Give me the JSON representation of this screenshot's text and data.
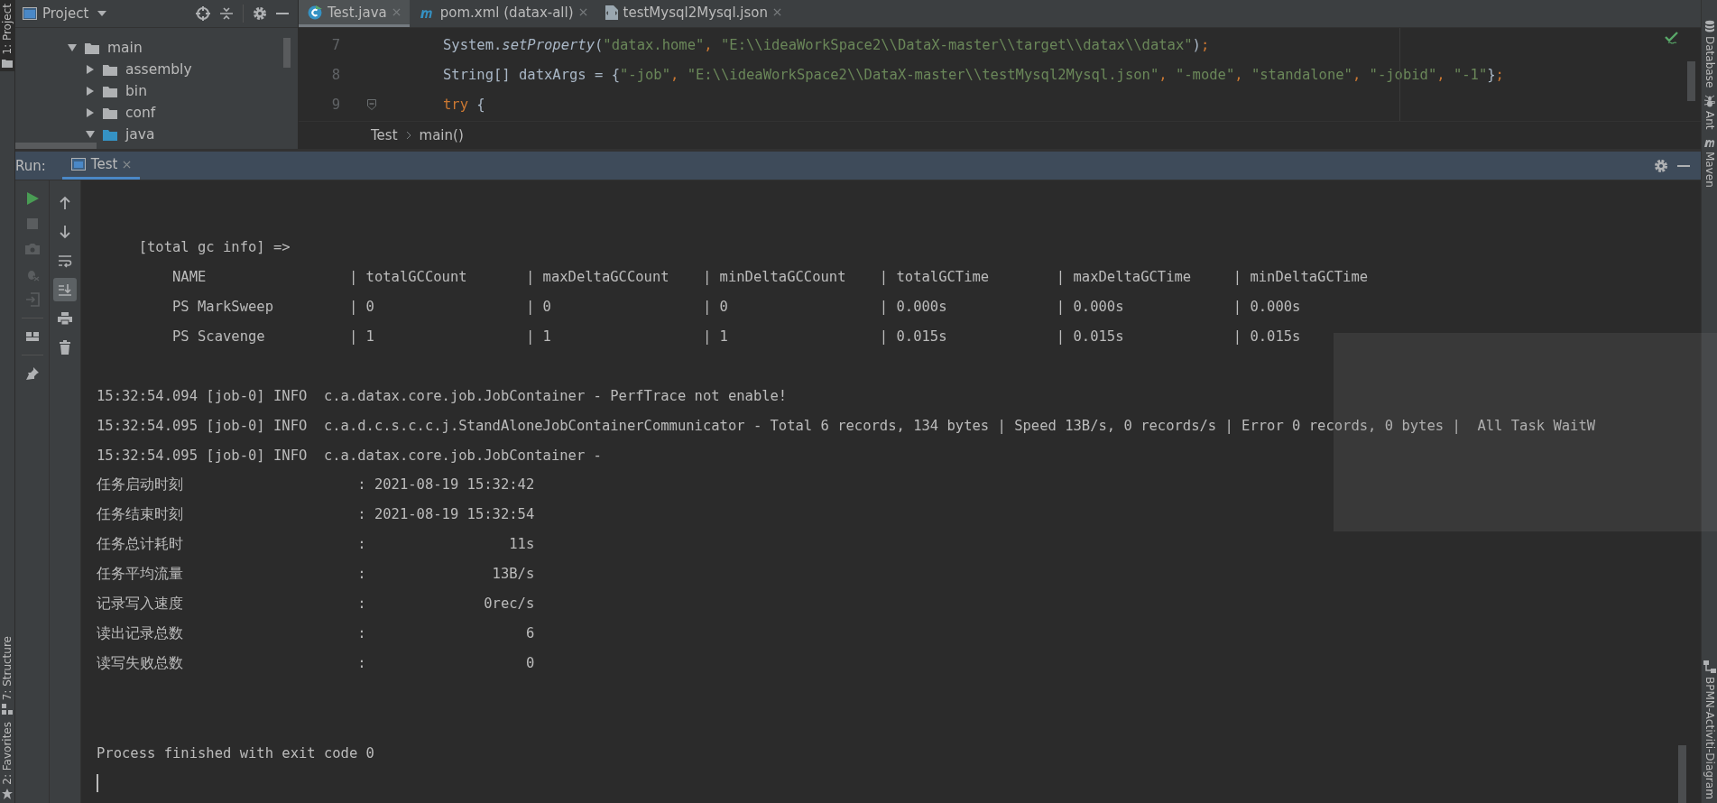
{
  "left_strip": [
    {
      "label": "1: Project",
      "selected": true
    },
    {
      "label": "7: Structure",
      "selected": false
    },
    {
      "label": "2: Favorites",
      "selected": false
    }
  ],
  "project_panel": {
    "title": "Project",
    "tree": [
      {
        "label": "main",
        "kind": "folder",
        "expanded": true,
        "children": [
          {
            "label": "assembly",
            "kind": "folder",
            "expanded": false
          },
          {
            "label": "bin",
            "kind": "folder",
            "expanded": false
          },
          {
            "label": "conf",
            "kind": "folder",
            "expanded": false
          },
          {
            "label": "java",
            "kind": "source",
            "expanded": true
          }
        ]
      }
    ]
  },
  "editor": {
    "tabs": [
      {
        "label": "Test.java",
        "kind": "java",
        "selected": true
      },
      {
        "label": "pom.xml (datax-all)",
        "kind": "maven",
        "selected": false
      },
      {
        "label": "testMysql2Mysql.json",
        "kind": "json",
        "selected": false
      }
    ],
    "lines": [
      {
        "number": "7",
        "tokens": [
          {
            "kind": "plain",
            "text": "System."
          },
          {
            "kind": "method",
            "text": "setProperty"
          },
          {
            "kind": "plain",
            "text": "("
          },
          {
            "kind": "string",
            "text": "\"datax.home\""
          },
          {
            "kind": "punct",
            "text": ", "
          },
          {
            "kind": "string",
            "text": "\"E:\\\\ideaWorkSpace2\\\\DataX-master\\\\target\\\\datax\\\\datax\""
          },
          {
            "kind": "plain",
            "text": ")"
          },
          {
            "kind": "punct",
            "text": ";"
          }
        ]
      },
      {
        "number": "8",
        "tokens": [
          {
            "kind": "plain",
            "text": "String[] datxArgs = {"
          },
          {
            "kind": "string",
            "text": "\"-job\""
          },
          {
            "kind": "punct",
            "text": ", "
          },
          {
            "kind": "string",
            "text": "\"E:\\\\ideaWorkSpace2\\\\DataX-master\\\\testMysql2Mysql.json\""
          },
          {
            "kind": "punct",
            "text": ", "
          },
          {
            "kind": "string",
            "text": "\"-mode\""
          },
          {
            "kind": "punct",
            "text": ", "
          },
          {
            "kind": "string",
            "text": "\"standalone\""
          },
          {
            "kind": "punct",
            "text": ", "
          },
          {
            "kind": "string",
            "text": "\"-jobid\""
          },
          {
            "kind": "punct",
            "text": ", "
          },
          {
            "kind": "string",
            "text": "\"-1\""
          },
          {
            "kind": "plain",
            "text": "}"
          },
          {
            "kind": "punct",
            "text": ";"
          }
        ]
      },
      {
        "number": "9",
        "tokens": [
          {
            "kind": "keyword",
            "text": "try"
          },
          {
            "kind": "plain",
            "text": " {"
          }
        ]
      }
    ],
    "breadcrumb": [
      "Test",
      "main()"
    ]
  },
  "run_panel": {
    "label": "Run:",
    "tab": "Test",
    "toolbar": [
      {
        "kind": "run",
        "disabled": false
      },
      {
        "kind": "stop",
        "disabled": true
      },
      {
        "kind": "camera",
        "disabled": true
      },
      {
        "kind": "bug",
        "disabled": true
      },
      {
        "kind": "exit",
        "disabled": true
      },
      {
        "kind": "layout",
        "disabled": false
      },
      {
        "kind": "pin",
        "disabled": false
      }
    ],
    "toolbar_2": [
      {
        "kind": "up",
        "on": false
      },
      {
        "kind": "down",
        "on": false
      },
      {
        "kind": "wrap",
        "on": false
      },
      {
        "kind": "scroll",
        "on": true
      },
      {
        "kind": "print",
        "on": false
      },
      {
        "kind": "trash",
        "on": false
      }
    ],
    "console": [
      {
        "kind": "blank"
      },
      {
        "kind": "text",
        "text": "     [total gc info] =>"
      },
      {
        "kind": "text",
        "text": "         NAME                 | totalGCCount       | maxDeltaGCCount    | minDeltaGCCount    | totalGCTime        | maxDeltaGCTime     | minDeltaGCTime"
      },
      {
        "kind": "text",
        "text": "         PS MarkSweep         | 0                  | 0                  | 0                  | 0.000s             | 0.000s             | 0.000s"
      },
      {
        "kind": "text",
        "text": "         PS Scavenge          | 1                  | 1                  | 1                  | 0.015s             | 0.015s             | 0.015s"
      },
      {
        "kind": "blank"
      },
      {
        "kind": "text",
        "text": "15:32:54.094 [job-0] INFO  c.a.datax.core.job.JobContainer - PerfTrace not enable!"
      },
      {
        "kind": "text",
        "text": "15:32:54.095 [job-0] INFO  c.a.d.c.s.c.c.j.StandAloneJobContainerCommunicator - Total 6 records, 134 bytes | Speed 13B/s, 0 records/s | Error 0 records, 0 bytes |  All Task WaitW"
      },
      {
        "kind": "text",
        "text": "15:32:54.095 [job-0] INFO  c.a.datax.core.job.JobContainer - "
      },
      {
        "kind": "stat",
        "label": "任务启动时刻",
        "value": ": 2021-08-19 15:32:42"
      },
      {
        "kind": "stat",
        "label": "任务结束时刻",
        "value": ": 2021-08-19 15:32:54"
      },
      {
        "kind": "stat",
        "label": "任务总计耗时",
        "value": ":                 11s"
      },
      {
        "kind": "stat",
        "label": "任务平均流量",
        "value": ":               13B/s"
      },
      {
        "kind": "stat",
        "label": "记录写入速度",
        "value": ":              0rec/s"
      },
      {
        "kind": "stat",
        "label": "读出记录总数",
        "value": ":                   6"
      },
      {
        "kind": "stat",
        "label": "读写失败总数",
        "value": ":                   0"
      },
      {
        "kind": "blank"
      },
      {
        "kind": "blank"
      },
      {
        "kind": "text",
        "text": "Process finished with exit code 0"
      },
      {
        "kind": "cursor"
      }
    ]
  },
  "right_strip": [
    "Database",
    "Ant",
    "Maven",
    "BPMN-Activiti-Diagram"
  ]
}
